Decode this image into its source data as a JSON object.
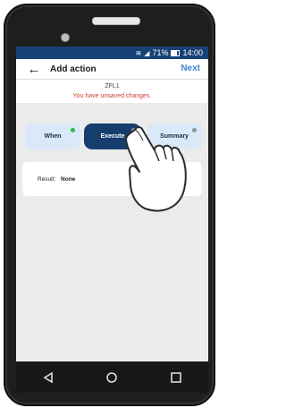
{
  "statusbar": {
    "signal_label": "◢",
    "wifi_label": "≋",
    "battery_text": "71%",
    "time": "14:00"
  },
  "header": {
    "title": "Add action",
    "next_label": "Next"
  },
  "subheader": {
    "name": "ZFL1",
    "warning": "You have unsaved changes."
  },
  "tabs": [
    {
      "label": "When",
      "status": "complete",
      "status_color": "#2fbd3d"
    },
    {
      "label": "Execute",
      "active": true,
      "status_color": "#8d949b"
    },
    {
      "label": "Summary",
      "status_color": "#8d949b"
    }
  ],
  "card": {
    "result_label": "Result:",
    "result_value": "None"
  },
  "icons": {
    "back": "arrow-left",
    "wifi": "wifi",
    "signal": "signal",
    "battery": "battery",
    "nav_back": "triangle-left",
    "nav_home": "circle",
    "nav_recent": "square"
  }
}
